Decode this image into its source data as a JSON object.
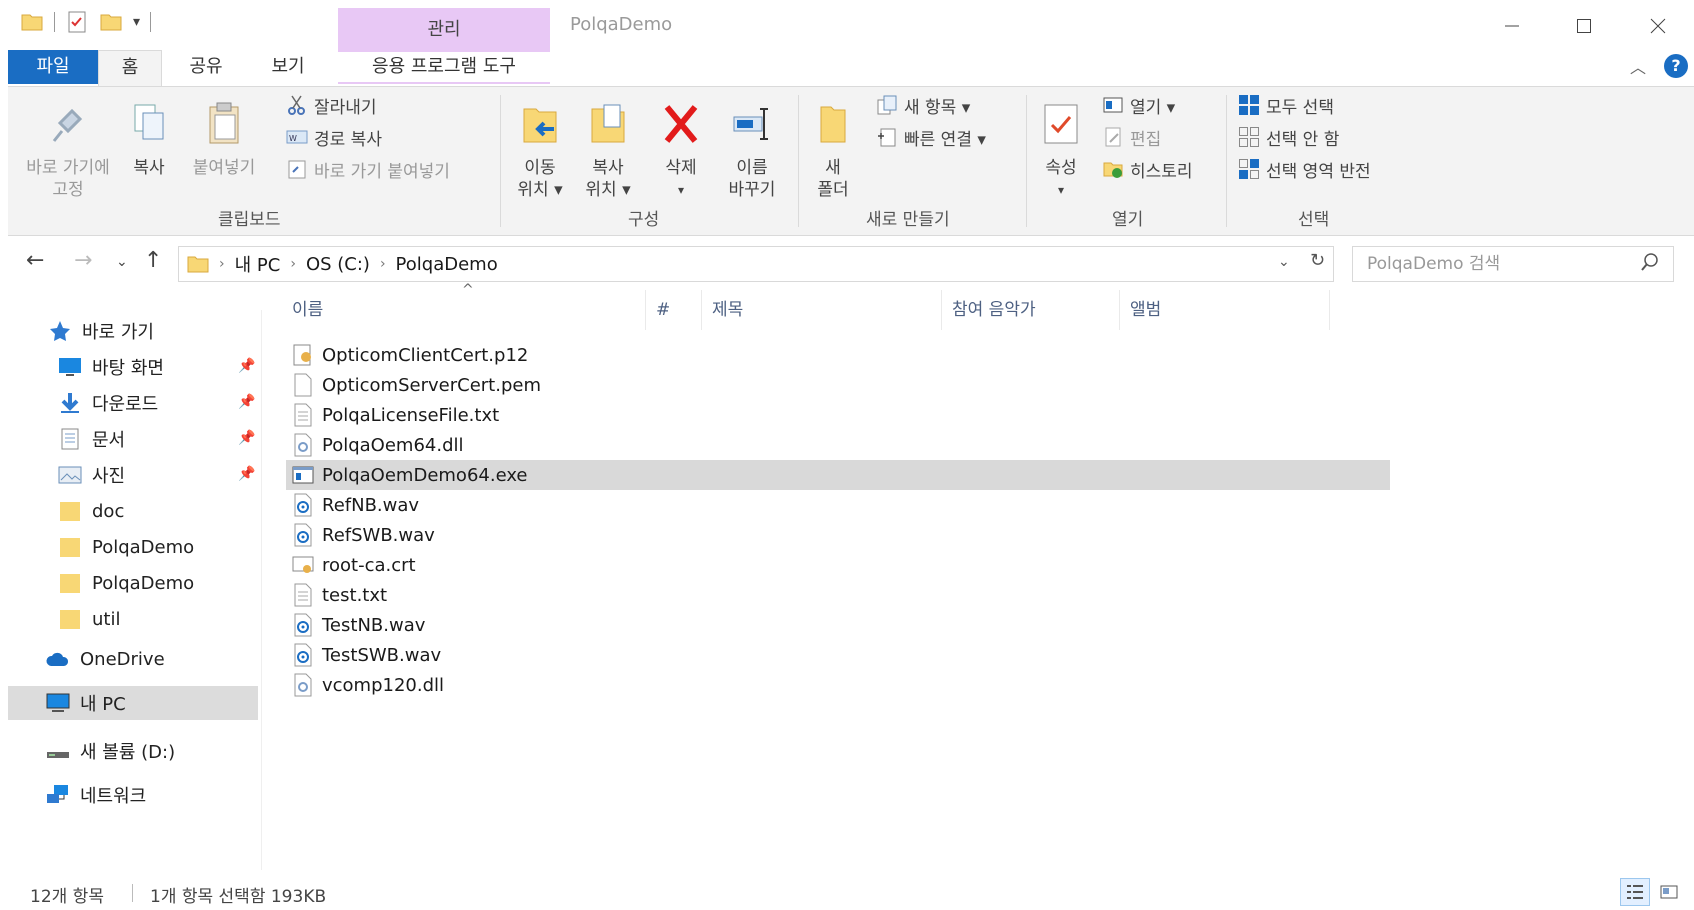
{
  "window": {
    "title": "PolqaDemo",
    "manage_tab": "관리"
  },
  "tabs": {
    "file": "파일",
    "home": "홈",
    "share": "공유",
    "view": "보기",
    "app_tools": "응용 프로그램 도구"
  },
  "ribbon": {
    "pin": "바로 가기에",
    "pin2": "고정",
    "copy": "복사",
    "paste": "붙여넣기",
    "cut": "잘라내기",
    "copy_path": "경로 복사",
    "paste_shortcut": "바로 가기 붙여넣기",
    "group_clipboard": "클립보드",
    "move_to": "이동",
    "move_to2": "위치 ▾",
    "copy_to": "복사",
    "copy_to2": "위치 ▾",
    "delete": "삭제",
    "delete2": "▾",
    "rename": "이름",
    "rename2": "바꾸기",
    "group_organize": "구성",
    "new_folder": "새",
    "new_folder2": "폴더",
    "new_item": "새 항목 ▾",
    "easy_access": "빠른 연결 ▾",
    "group_new": "새로 만들기",
    "properties": "속성",
    "properties2": "▾",
    "open": "열기 ▾",
    "edit": "편집",
    "history": "히스토리",
    "group_open": "열기",
    "select_all": "모두 선택",
    "select_none": "선택 안 함",
    "invert_selection": "선택 영역 반전",
    "group_select": "선택"
  },
  "address": {
    "crumbs": [
      "내 PC",
      "OS (C:)",
      "PolqaDemo"
    ],
    "search_placeholder": "PolqaDemo 검색"
  },
  "navpane": {
    "quick_access": "바로 가기",
    "desktop": "바탕 화면",
    "downloads": "다운로드",
    "documents": "문서",
    "pictures": "사진",
    "folders": [
      "doc",
      "PolqaDemo",
      "PolqaDemo",
      "util"
    ],
    "onedrive": "OneDrive",
    "this_pc": "내 PC",
    "new_volume": "새 볼륨 (D:)",
    "network": "네트워크"
  },
  "columns": {
    "name": "이름",
    "number": "#",
    "title": "제목",
    "artists": "참여 음악가",
    "album": "앨범"
  },
  "files": [
    {
      "name": "OpticomClientCert.p12",
      "icon": "cert-icon"
    },
    {
      "name": "OpticomServerCert.pem",
      "icon": "blank-file-icon"
    },
    {
      "name": "PolqaLicenseFile.txt",
      "icon": "text-file-icon"
    },
    {
      "name": "PolqaOem64.dll",
      "icon": "dll-icon"
    },
    {
      "name": "PolqaOemDemo64.exe",
      "icon": "exe-icon"
    },
    {
      "name": "RefNB.wav",
      "icon": "audio-icon"
    },
    {
      "name": "RefSWB.wav",
      "icon": "audio-icon"
    },
    {
      "name": "root-ca.crt",
      "icon": "certificate-icon"
    },
    {
      "name": "test.txt",
      "icon": "text-file-icon"
    },
    {
      "name": "TestNB.wav",
      "icon": "audio-icon"
    },
    {
      "name": "TestSWB.wav",
      "icon": "audio-icon"
    },
    {
      "name": "vcomp120.dll",
      "icon": "dll-icon"
    }
  ],
  "status": {
    "count": "12개 항목",
    "selected": "1개 항목 선택함 193KB"
  },
  "colors": {
    "file_tab": "#1a6dc3",
    "manage_tab": "#e8c8f5",
    "selected_row": "#d9d9d9",
    "folder": "#f8d775"
  }
}
